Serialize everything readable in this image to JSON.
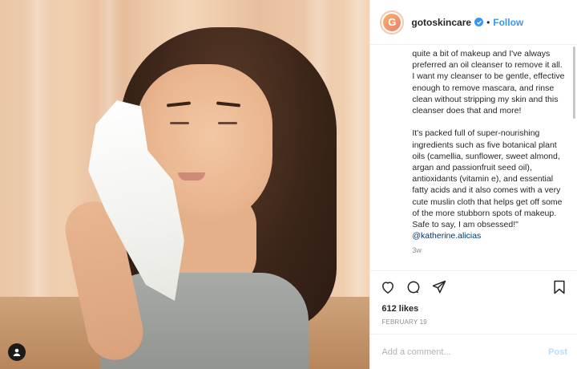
{
  "account": {
    "avatar_letter": "G",
    "username": "gotoskincare",
    "separator": "•",
    "follow_label": "Follow"
  },
  "caption": {
    "text_before_mention": "quite a bit of makeup and I've always preferred an oil cleanser to remove it all. I want my cleanser to be gentle, effective enough to remove mascara, and rinse clean without stripping my skin and this cleanser does that and more!\n\nIt's packed full of super-nourishing ingredients such as five botanical plant oils (camellia, sunflower, sweet almond, argan and passionfruit seed oil), antioxidants (vitamin e), and essential fatty acids and it also comes with a very cute muslin cloth that helps get off some of the more stubborn spots of makeup. Safe to say, I am obsessed!\"\n",
    "mention": "@katherine.alicias",
    "time_ago": "3w"
  },
  "stats": {
    "likes": "612 likes",
    "date": "FEBRUARY 19"
  },
  "comment": {
    "placeholder": "Add a comment...",
    "post_label": "Post"
  },
  "icons": {
    "heart": "heart-icon",
    "comment": "comment-icon",
    "share": "share-icon",
    "bookmark": "bookmark-icon",
    "user_tag": "user-tag-icon",
    "verified": "verified-badge-icon"
  },
  "colors": {
    "accent_blue": "#3897f0",
    "text": "#262626",
    "muted": "#8e8e8e",
    "post_disabled": "#b2dffc"
  }
}
